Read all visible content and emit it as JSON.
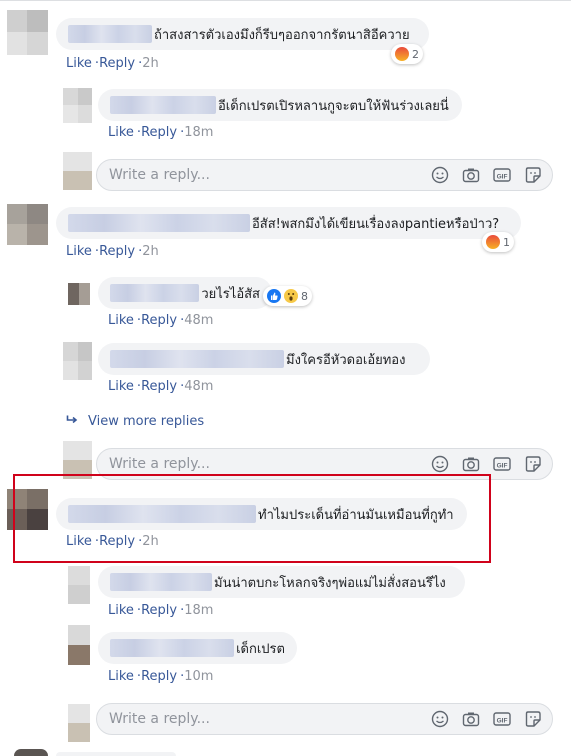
{
  "actions": {
    "like": "Like",
    "reply": "Reply",
    "separator": "·"
  },
  "comments": [
    {
      "text": "ถ้าสงสารตัวเองมึงก็รีบๆออกจากรัตนาสิอีควาย",
      "time": "2h",
      "reaction_count": "2",
      "reaction": "angry-icon"
    },
    {
      "text": "อีเด็กเปรตเปิรหลานกูจะตบให้ฟันร่วงเลยนี่",
      "time": "18m"
    },
    {
      "text": "อีสัส!พสกมึงได้เขียนเรื่องลงpantieหรือป่าว?",
      "time": "2h",
      "reaction_count": "1",
      "reaction": "angry-icon"
    },
    {
      "text": "วยไรไอ้สัส",
      "time": "48m",
      "reaction_count": "8",
      "reaction": "like-wow"
    },
    {
      "text": "มึงใครอีหัวดอเอ้ยทอง",
      "time": "48m"
    },
    {
      "text": "ทำไมประเด็นที่อ่านมันเหมือนที่กูทำ",
      "time": "2h"
    },
    {
      "text": "มันน่าตบกะโหลกจริงๆพ่อแม่ไม่สั่งสอนรึไง",
      "time": "18m"
    },
    {
      "text": "เด็กเปรต",
      "time": "10m"
    }
  ],
  "view_more": "View more replies",
  "reply_box": {
    "placeholder": "Write a reply..."
  },
  "colors": {
    "link": "#385898",
    "bubble": "#f2f3f5",
    "highlight": "#d0021b"
  }
}
